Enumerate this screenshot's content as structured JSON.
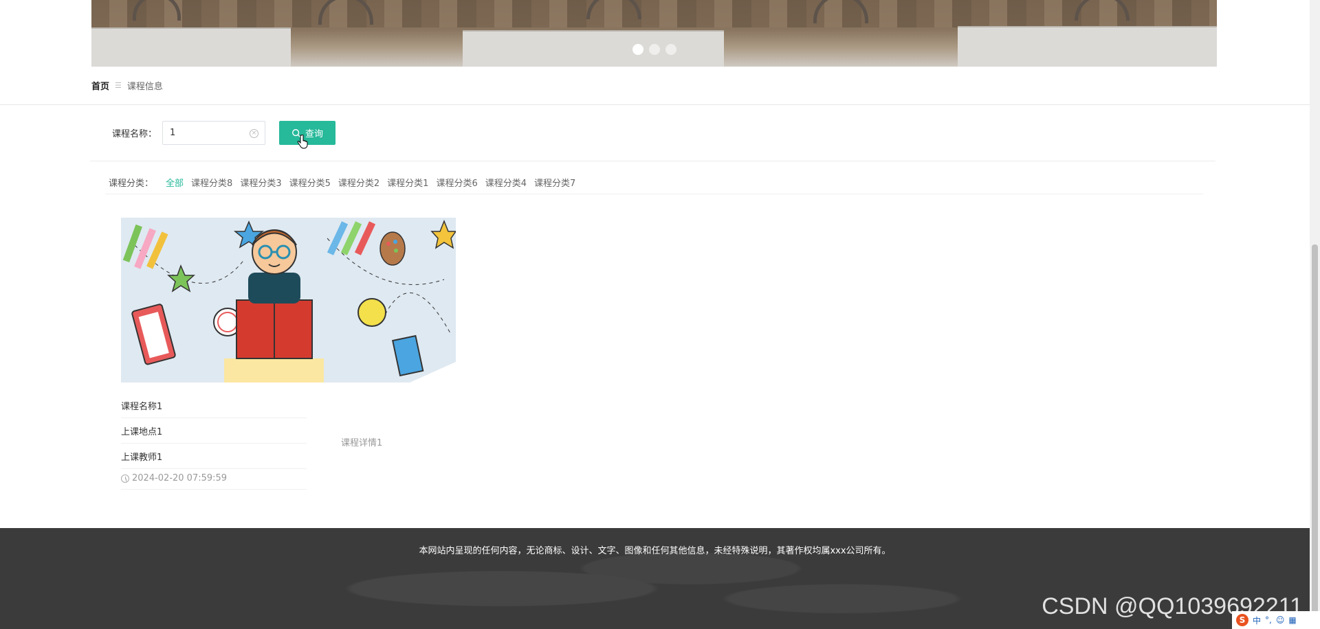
{
  "banner": {
    "dots": 3,
    "active_dot": 0
  },
  "breadcrumb": {
    "home": "首页",
    "separator": "☰",
    "current": "课程信息"
  },
  "search": {
    "label": "课程名称：",
    "value": "1",
    "button_label": "查询"
  },
  "categories": {
    "label": "课程分类：",
    "items": [
      "全部",
      "课程分类8",
      "课程分类3",
      "课程分类5",
      "课程分类2",
      "课程分类1",
      "课程分类6",
      "课程分类4",
      "课程分类7"
    ],
    "active": "全部"
  },
  "course": {
    "name": "课程名称1",
    "location": "上课地点1",
    "teacher": "上课教师1",
    "time": "2024-02-20 07:59:59",
    "detail": "课程详情1"
  },
  "footer": {
    "copyright": "本网站内呈现的任何内容，无论商标、设计、文字、图像和任何其他信息，未经特殊说明，其著作权均属xxx公司所有。",
    "watermark": "CSDN @QQ1039692211"
  },
  "ime": {
    "logo": "S",
    "mode": "中"
  },
  "colors": {
    "accent": "#26b99a",
    "footer_bg": "#3b3b3b"
  }
}
